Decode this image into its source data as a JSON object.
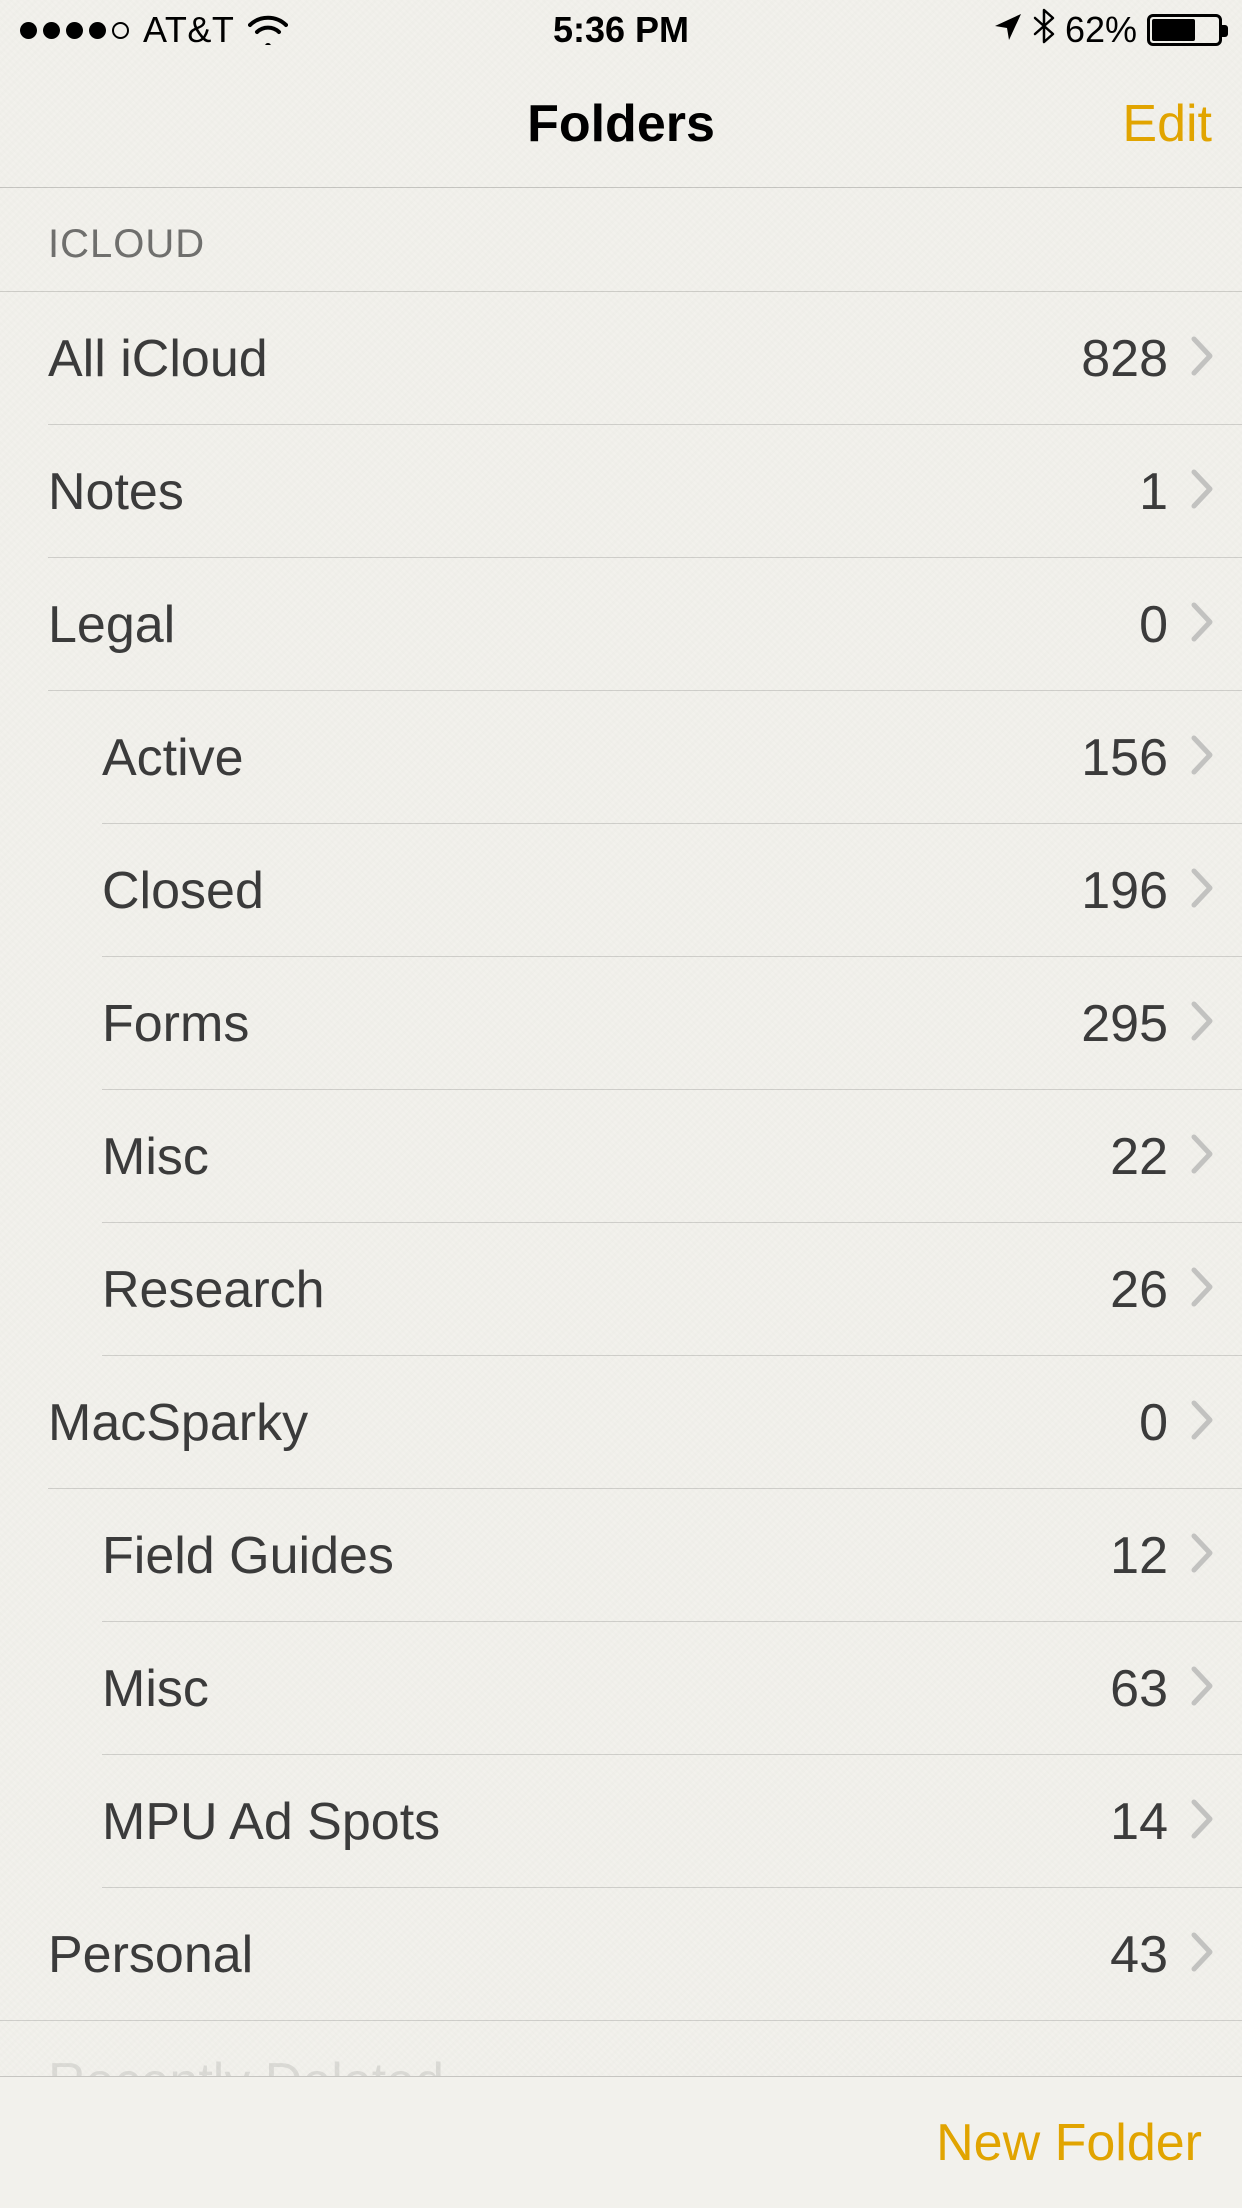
{
  "status_bar": {
    "carrier": "AT&T",
    "time": "5:36 PM",
    "battery_percent": "62%",
    "battery_fill_pct": 62
  },
  "nav": {
    "title": "Folders",
    "edit_label": "Edit"
  },
  "section": {
    "header": "ICLOUD"
  },
  "folders": [
    {
      "name": "All iCloud",
      "count": "828",
      "level": 0
    },
    {
      "name": "Notes",
      "count": "1",
      "level": 0
    },
    {
      "name": "Legal",
      "count": "0",
      "level": 0
    },
    {
      "name": "Active",
      "count": "156",
      "level": 1
    },
    {
      "name": "Closed",
      "count": "196",
      "level": 1
    },
    {
      "name": "Forms",
      "count": "295",
      "level": 1
    },
    {
      "name": "Misc",
      "count": "22",
      "level": 1
    },
    {
      "name": "Research",
      "count": "26",
      "level": 1
    },
    {
      "name": "MacSparky",
      "count": "0",
      "level": 0
    },
    {
      "name": "Field Guides",
      "count": "12",
      "level": 1
    },
    {
      "name": "Misc",
      "count": "63",
      "level": 1
    },
    {
      "name": "MPU Ad Spots",
      "count": "14",
      "level": 1
    },
    {
      "name": "Personal",
      "count": "43",
      "level": 0
    }
  ],
  "recently_deleted_label": "Recently Deleted",
  "toolbar": {
    "new_folder_label": "New Folder"
  },
  "colors": {
    "accent": "#e1a400"
  }
}
